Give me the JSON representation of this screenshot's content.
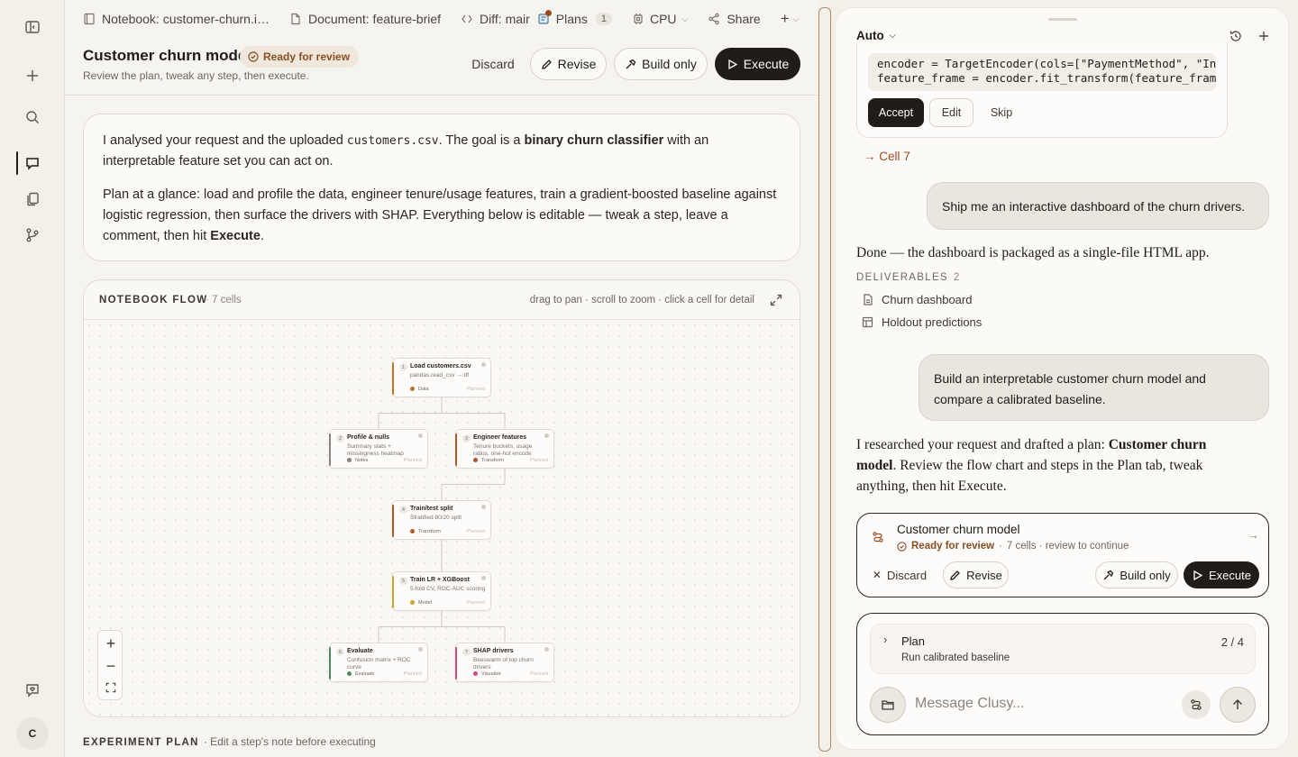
{
  "rail": {
    "avatar_initial": "C"
  },
  "tabs": [
    {
      "label": "Notebook: customer-churn.i…",
      "icon": "notebook-icon"
    },
    {
      "label": "Document: feature-brief",
      "icon": "document-icon"
    },
    {
      "label": "Diff: mair",
      "icon": "diff-icon"
    },
    {
      "label": "Plans",
      "icon": "plans-icon",
      "count": "1"
    },
    {
      "label": "CPU",
      "icon": "cpu-icon"
    },
    {
      "label": "Share",
      "icon": "share-icon"
    }
  ],
  "header": {
    "title": "Customer churn model",
    "status": "Ready for review",
    "subtitle": "Review the plan, tweak any step, then execute.",
    "discard": "Discard",
    "revise": "Revise",
    "build_only": "Build only",
    "execute": "Execute"
  },
  "intro": {
    "p1_a": "I analysed your request and the uploaded ",
    "p1_file": "customers.csv",
    "p1_b": ". The goal is a ",
    "p1_bold": "binary churn classifier",
    "p1_c": " with an interpretable feature set you can act on.",
    "p2_a": "Plan at a glance: load and profile the data, engineer tenure/usage features, train a gradient-boosted baseline against logistic regression, then surface the drivers with SHAP. Everything below is editable — tweak a step, leave a comment, then hit ",
    "p2_bold": "Execute",
    "p2_c": "."
  },
  "flow": {
    "title": "NOTEBOOK FLOW",
    "count": "· 7 cells",
    "hint": "drag to pan · scroll to zoom · click a cell for detail",
    "nodes": [
      {
        "num": "1",
        "title": "Load customers.csv",
        "desc": "pandas.read_csv → df",
        "kind": "Data",
        "status": "Planned",
        "color": "#c0742e"
      },
      {
        "num": "2",
        "title": "Profile & nulls",
        "desc": "Summary stats + missingness heatmap",
        "kind": "Notes",
        "status": "Planned",
        "color": "#8a847b"
      },
      {
        "num": "3",
        "title": "Engineer features",
        "desc": "Tenure buckets, usage ratios, one-hot encode",
        "kind": "Transform",
        "status": "Planned",
        "color": "#b0582a"
      },
      {
        "num": "4",
        "title": "Train/test split",
        "desc": "Stratified 80/20 split",
        "kind": "Transform",
        "status": "Planned",
        "color": "#b0582a"
      },
      {
        "num": "5",
        "title": "Train LR + XGBoost",
        "desc": "5-fold CV, ROC-AUC scoring",
        "kind": "Model",
        "status": "Planned",
        "color": "#d0a030"
      },
      {
        "num": "6",
        "title": "Evaluate",
        "desc": "Confusion matrix + ROC curve",
        "kind": "Evaluate",
        "status": "Planned",
        "color": "#4f8a5c"
      },
      {
        "num": "7",
        "title": "SHAP drivers",
        "desc": "Beeswarm of top churn drivers",
        "kind": "Visualize",
        "status": "Planned",
        "color": "#d04a78"
      }
    ]
  },
  "plan_section": {
    "title": "EXPERIMENT PLAN",
    "hint": "· Edit a step's note before executing"
  },
  "chat": {
    "mode": "Auto",
    "code_lines": [
      "encoder = TargetEncoder(cols=[\"PaymentMethod\", \"Inte",
      "feature_frame = encoder.fit_transform(feature_frame,"
    ],
    "accept": "Accept",
    "edit": "Edit",
    "skip": "Skip",
    "cell_link": "→ Cell 7",
    "user_msg_1": "Ship me an interactive dashboard of the churn drivers.",
    "reply_1": "Done — the dashboard is packaged as a single-file HTML app.",
    "deliverables_label": "DELIVERABLES",
    "deliverables_count": "2",
    "deliverables": [
      "Churn dashboard",
      "Holdout predictions"
    ],
    "user_msg_2": "Build an interpretable customer churn model and compare a calibrated baseline.",
    "reply_2_a": "I researched your request and drafted a plan: ",
    "reply_2_bold": "Customer churn model",
    "reply_2_b": ". Review the flow chart and steps in the Plan tab, tweak anything, then hit Execute.",
    "plan_card": {
      "title": "Customer churn model",
      "status": "Ready for review",
      "meta": "7 cells · review to continue",
      "discard": "Discard",
      "revise": "Revise",
      "build_only": "Build only",
      "execute": "Execute"
    },
    "plan_step": {
      "label": "Plan",
      "step": "Run calibrated baseline",
      "progress": "2 / 4"
    },
    "composer_placeholder": "Message Clusy..."
  }
}
